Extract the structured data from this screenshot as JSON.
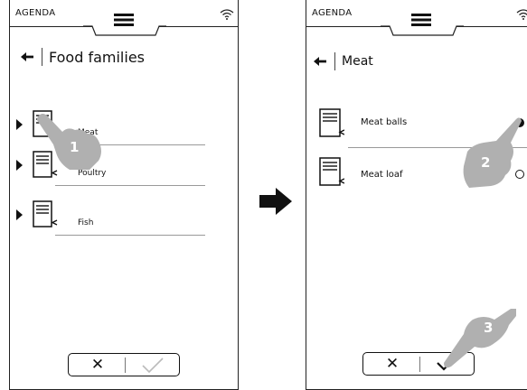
{
  "left_screen": {
    "status_label": "AGENDA",
    "title": "Food families",
    "items": [
      {
        "label": "Meat"
      },
      {
        "label": "Poultry"
      },
      {
        "label": "Fish"
      }
    ],
    "cancel_glyph": "✕",
    "step_number": "1"
  },
  "right_screen": {
    "status_label": "AGENDA",
    "title": "Meat",
    "items": [
      {
        "label": "Meat balls",
        "selected": true
      },
      {
        "label": "Meat loaf",
        "selected": false
      }
    ],
    "cancel_glyph": "✕",
    "step_numbers": [
      "2",
      "3"
    ]
  },
  "icons": [
    "menu-icon",
    "wifi-icon",
    "back-arrow-icon",
    "recipe-book-icon",
    "expand-caret-icon",
    "check-icon",
    "close-icon",
    "pointing-hand-icon",
    "transition-arrow-icon"
  ],
  "colors": {
    "hand_gray": "#b0b0b0",
    "ink": "#111111"
  }
}
